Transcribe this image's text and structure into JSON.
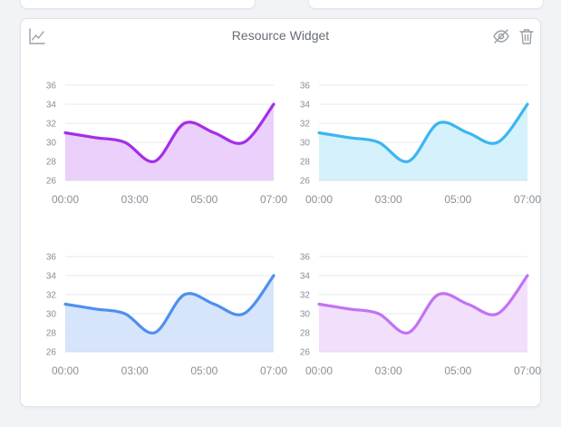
{
  "widget": {
    "title": "Resource Widget",
    "icons": {
      "type": "line-chart-icon",
      "hide": "eye-off-icon",
      "delete": "trash-icon"
    }
  },
  "chart_data": [
    {
      "type": "area",
      "x_labels": [
        "00:00",
        "03:00",
        "05:00",
        "07:00"
      ],
      "y_ticks": [
        26,
        28,
        30,
        32,
        34,
        36
      ],
      "ylim": [
        26,
        36
      ],
      "grid": true,
      "series": [
        {
          "color": "#a42ee8",
          "fill": "#e6c8fa",
          "values": [
            31,
            30.5,
            30,
            28,
            32,
            31,
            30,
            34
          ]
        }
      ]
    },
    {
      "type": "area",
      "x_labels": [
        "00:00",
        "03:00",
        "05:00",
        "07:00"
      ],
      "y_ticks": [
        26,
        28,
        30,
        32,
        34,
        36
      ],
      "ylim": [
        26,
        36
      ],
      "grid": true,
      "series": [
        {
          "color": "#3bb6ef",
          "fill": "#cdeefc",
          "values": [
            31,
            30.5,
            30,
            28,
            32,
            31,
            30,
            34
          ]
        }
      ]
    },
    {
      "type": "area",
      "x_labels": [
        "00:00",
        "03:00",
        "05:00",
        "07:00"
      ],
      "y_ticks": [
        26,
        28,
        30,
        32,
        34,
        36
      ],
      "ylim": [
        26,
        36
      ],
      "grid": true,
      "series": [
        {
          "color": "#4f8fee",
          "fill": "#cfe0fb",
          "values": [
            31,
            30.5,
            30,
            28,
            32,
            31,
            30,
            34
          ]
        }
      ]
    },
    {
      "type": "area",
      "x_labels": [
        "00:00",
        "03:00",
        "05:00",
        "07:00"
      ],
      "y_ticks": [
        26,
        28,
        30,
        32,
        34,
        36
      ],
      "ylim": [
        26,
        36
      ],
      "grid": true,
      "series": [
        {
          "color": "#c173f2",
          "fill": "#f0d9fc",
          "values": [
            31,
            30.5,
            30,
            28,
            32,
            31,
            30,
            34
          ]
        }
      ]
    }
  ]
}
